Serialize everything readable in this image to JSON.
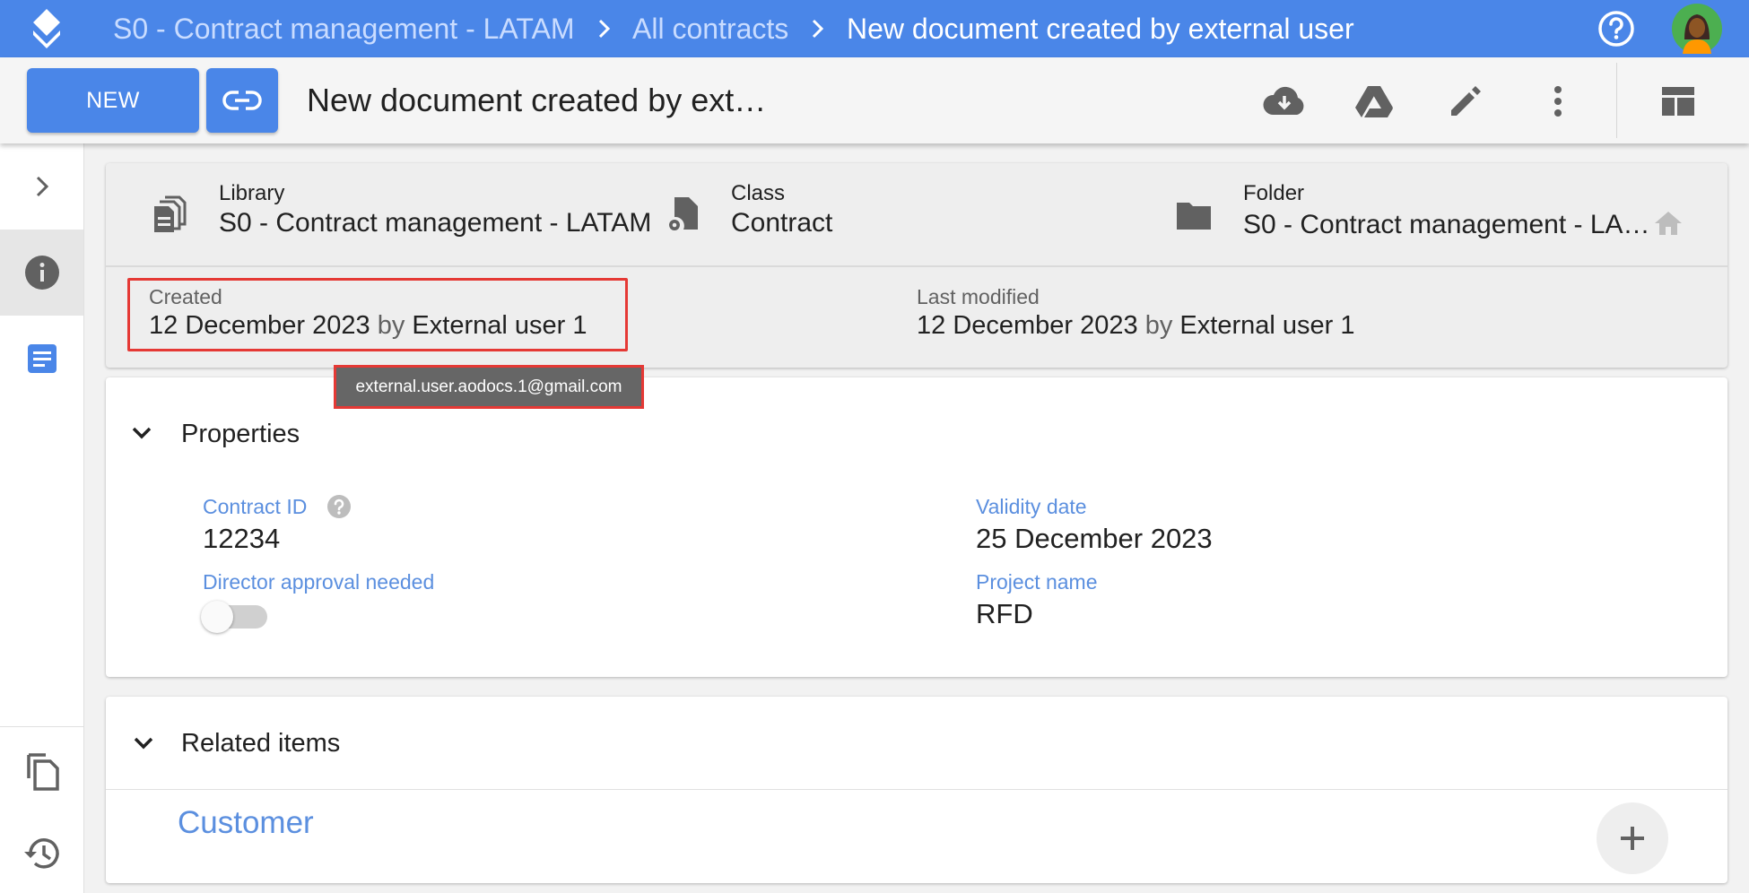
{
  "breadcrumb": {
    "items": [
      "S0 - Contract management - LATAM",
      "All contracts",
      "New document created by external user"
    ]
  },
  "toolbar": {
    "new_label": "NEW",
    "document_title": "New document created by ext…",
    "icons": [
      "link-icon",
      "cloud-download-icon",
      "drive-icon",
      "edit-icon",
      "more-vert-icon",
      "layout-icon"
    ]
  },
  "header": {
    "library_label": "Library",
    "library_value": "S0 - Contract management - LATAM",
    "class_label": "Class",
    "class_value": "Contract",
    "folder_label": "Folder",
    "folder_value": "S0 - Contract management - LA…"
  },
  "audit": {
    "created_label": "Created",
    "created_date": "12 December 2023",
    "created_by_word": "by",
    "created_user": "External user 1",
    "modified_label": "Last modified",
    "modified_date": "12 December 2023",
    "modified_by_word": "by",
    "modified_user": "External user 1",
    "tooltip_email": "external.user.aodocs.1@gmail.com"
  },
  "properties": {
    "section_title": "Properties",
    "contract_id_label": "Contract ID",
    "contract_id_value": "12234",
    "director_approval_label": "Director approval needed",
    "director_approval_value": false,
    "validity_date_label": "Validity date",
    "validity_date_value": "25 December 2023",
    "project_name_label": "Project name",
    "project_name_value": "RFD"
  },
  "related": {
    "section_title": "Related items",
    "customer_label": "Customer"
  },
  "colors": {
    "brand_blue": "#4a86e8",
    "label_blue": "#5b8fdf",
    "highlight_red": "#e53935",
    "tooltip_grey": "#666666"
  }
}
